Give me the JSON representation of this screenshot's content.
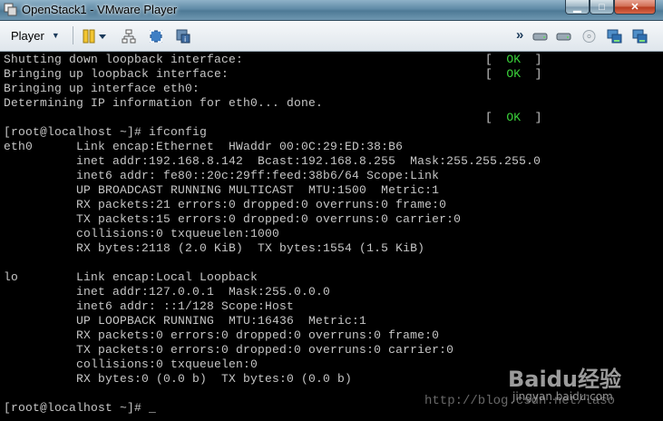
{
  "window": {
    "title": "OpenStack1 - VMware Player",
    "min_glyph": "▁",
    "max_glyph": "□",
    "close_glyph": "✕"
  },
  "toolbar": {
    "player_label": "Player",
    "caret": "▼",
    "forward_glyph": "»"
  },
  "console": {
    "lines": [
      "Shutting down loopback interface:",
      "Bringing up loopback interface:",
      "Bringing up interface eth0:",
      "Determining IP information for eth0... done.",
      "",
      "[root@localhost ~]# ifconfig",
      "eth0      Link encap:Ethernet  HWaddr 00:0C:29:ED:38:B6",
      "          inet addr:192.168.8.142  Bcast:192.168.8.255  Mask:255.255.255.0",
      "          inet6 addr: fe80::20c:29ff:feed:38b6/64 Scope:Link",
      "          UP BROADCAST RUNNING MULTICAST  MTU:1500  Metric:1",
      "          RX packets:21 errors:0 dropped:0 overruns:0 frame:0",
      "          TX packets:15 errors:0 dropped:0 overruns:0 carrier:0",
      "          collisions:0 txqueuelen:1000",
      "          RX bytes:2118 (2.0 KiB)  TX bytes:1554 (1.5 KiB)",
      "",
      "lo        Link encap:Local Loopback",
      "          inet addr:127.0.0.1  Mask:255.0.0.0",
      "          inet6 addr: ::1/128 Scope:Host",
      "          UP LOOPBACK RUNNING  MTU:16436  Metric:1",
      "          RX packets:0 errors:0 dropped:0 overruns:0 frame:0",
      "          TX packets:0 errors:0 dropped:0 overruns:0 carrier:0",
      "          collisions:0 txqueuelen:0",
      "          RX bytes:0 (0.0 b)  TX bytes:0 (0.0 b)",
      "",
      "[root@localhost ~]# _"
    ],
    "status_open": "[  ",
    "status_ok": "OK",
    "status_close": "  ]",
    "watermark_brand": "Baidu经验",
    "watermark_site": "jingyan.baidu.com",
    "watermark_url": "http://blog.csdn.net/laso"
  },
  "colors": {
    "ok_green": "#3bd53b",
    "terminal_text": "#c6c6c6"
  }
}
